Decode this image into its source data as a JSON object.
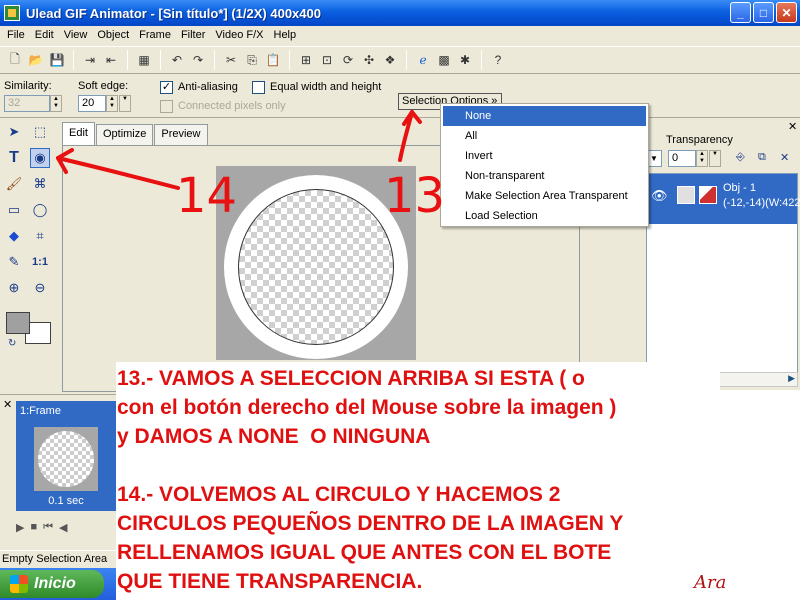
{
  "window": {
    "title": "Ulead GIF Animator - [Sin título*] (1/2X)  400x400",
    "min": "_",
    "max": "□",
    "close": "✕"
  },
  "menu": [
    "File",
    "Edit",
    "View",
    "Object",
    "Frame",
    "Filter",
    "Video F/X",
    "Help"
  ],
  "toolbar_icons": [
    "new-icon",
    "open-icon",
    "save-icon",
    "import-icon",
    "export-icon",
    "palette-icon",
    "undo-icon",
    "redo-icon",
    "cut-icon",
    "copy-icon",
    "paste-icon",
    "crop-icon",
    "resize-icon",
    "rotate-icon",
    "flip-icon",
    "browser-preview-icon",
    "optimize-icon",
    "help-cursor-icon"
  ],
  "props": {
    "similarity_label": "Similarity:",
    "similarity_value": "32",
    "soft_edge_label": "Soft edge:",
    "soft_edge_value": "20",
    "anti_aliasing": "Anti-aliasing",
    "anti_aliasing_checked": "✓",
    "equal_wh": "Equal width and height",
    "connected_pixels": "Connected pixels only",
    "selection_options": "Selection Options »"
  },
  "tools": {
    "text": "T",
    "zoom_1to1": "1:1"
  },
  "tabs": [
    "Edit",
    "Optimize",
    "Preview"
  ],
  "context_menu": [
    {
      "label": "None",
      "highlight": true
    },
    {
      "label": "All"
    },
    {
      "label": "Invert"
    },
    {
      "label": "Non-transparent"
    },
    {
      "label": "Make Selection Area Transparent"
    },
    {
      "label": "Load Selection"
    }
  ],
  "object_panel": {
    "close": "✕",
    "transparency_label": "Transparency",
    "transparency_value": "0",
    "obj_name": "Obj - 1",
    "obj_coords": "(-12,-14)(W:422"
  },
  "frame_panel": {
    "close": "✕",
    "frame_label": "1:Frame",
    "delay": "0.1 sec"
  },
  "status": "Empty Selection Area",
  "taskbar": {
    "start": "Inicio"
  },
  "tutorial": {
    "step13": "13.- VAMOS A SELECCION ARRIBA SI ESTA ( o\ncon el botón derecho del Mouse sobre la imagen )\ny DAMOS A NONE  O NINGUNA",
    "step14": "14.- VOLVEMOS AL CIRCULO Y HACEMOS 2\nCIRCULOS PEQUEÑOS DENTRO DE LA IMAGEN Y\nRELLENAMOS IGUAL QUE ANTES CON EL BOTE\nQUE TIENE TRANSPARENCIA."
  },
  "annotations": {
    "label14": "14",
    "label13": "13",
    "color": "#e81010"
  },
  "signature": "Ara"
}
